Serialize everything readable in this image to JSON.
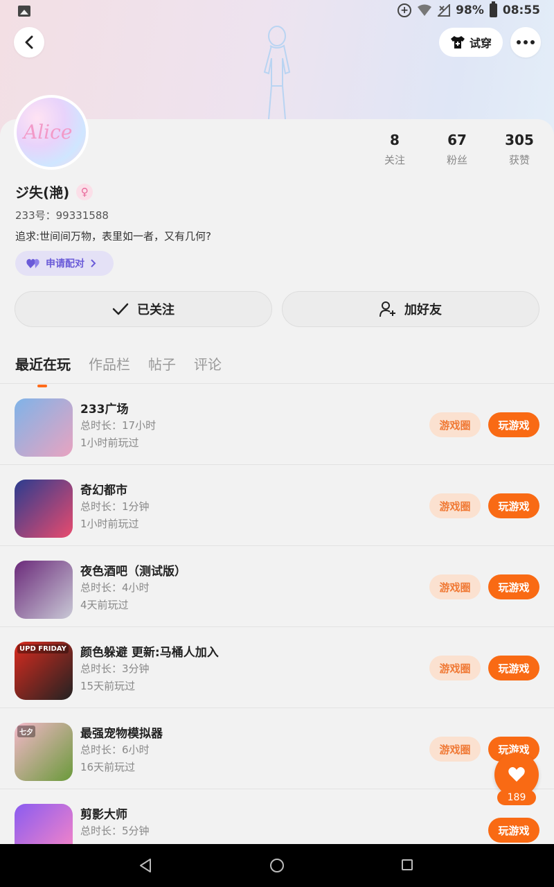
{
  "status_bar": {
    "battery": "98%",
    "time": "08:55"
  },
  "header": {
    "tryon_label": "试穿"
  },
  "profile": {
    "avatar_text": "Alice",
    "name": "ジ失(滟)",
    "gender_symbol": "♀",
    "uid": "233号：99331588",
    "bio": "追求:世间间万物，表里如一者，又有几何?",
    "pair_label": "申请配对"
  },
  "stats": [
    {
      "value": "8",
      "label": "关注"
    },
    {
      "value": "67",
      "label": "粉丝"
    },
    {
      "value": "305",
      "label": "获赞"
    }
  ],
  "actions": {
    "follow_label": "已关注",
    "add_friend_label": "加好友"
  },
  "tabs": [
    {
      "label": "最近在玩",
      "active": true
    },
    {
      "label": "作品栏",
      "active": false
    },
    {
      "label": "帖子",
      "active": false
    },
    {
      "label": "评论",
      "active": false
    }
  ],
  "games": [
    {
      "title": "233广场",
      "duration": "总时长：17小时",
      "last_played": "1小时前玩过",
      "circle_label": "游戏圈",
      "play_label": "玩游戏",
      "icon_colors": [
        "#7fb3e8",
        "#e9a3c0"
      ]
    },
    {
      "title": "奇幻都市",
      "duration": "总时长：1分钟",
      "last_played": "1小时前玩过",
      "circle_label": "游戏圈",
      "play_label": "玩游戏",
      "icon_colors": [
        "#2b3c8f",
        "#e94b6e"
      ]
    },
    {
      "title": "夜色酒吧（测试版）",
      "duration": "总时长：4小时",
      "last_played": "4天前玩过",
      "circle_label": "游戏圈",
      "play_label": "玩游戏",
      "icon_colors": [
        "#6b2a7a",
        "#c9c9d6"
      ]
    },
    {
      "title": "颜色躲避 更新:马桶人加入",
      "duration": "总时长：3分钟",
      "last_played": "15天前玩过",
      "circle_label": "游戏圈",
      "play_label": "玩游戏",
      "icon_colors": [
        "#d92b1f",
        "#222222"
      ],
      "icon_text": "UPD FRIDAY"
    },
    {
      "title": "最强宠物模拟器",
      "duration": "总时长：6小时",
      "last_played": "16天前玩过",
      "circle_label": "游戏圈",
      "play_label": "玩游戏",
      "icon_colors": [
        "#f3b7c9",
        "#6a9a3a"
      ],
      "icon_text": "七夕"
    },
    {
      "title": "剪影大师",
      "duration": "总时长：5分钟",
      "last_played": "",
      "circle_label": "",
      "play_label": "玩游戏",
      "icon_colors": [
        "#8a5cf0",
        "#ff88c4"
      ]
    }
  ],
  "floating": {
    "count": "189"
  }
}
